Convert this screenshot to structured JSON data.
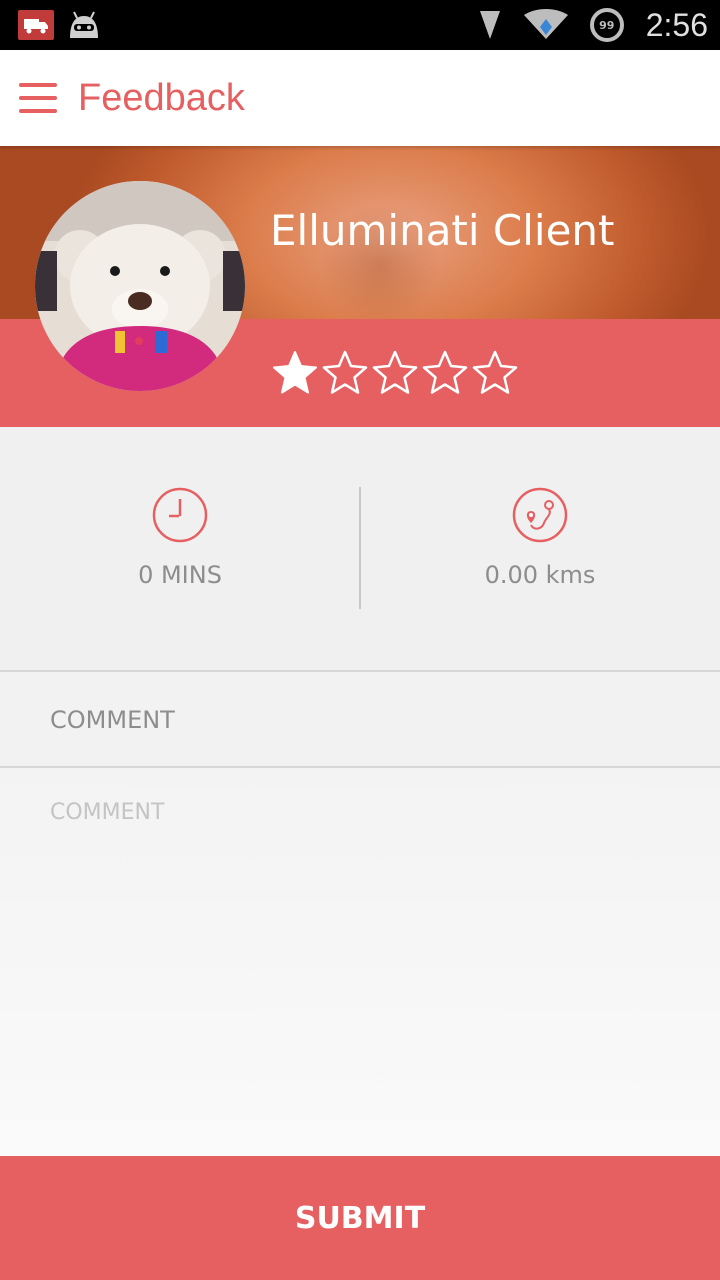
{
  "status_bar": {
    "time": "2:56",
    "battery": "99",
    "icons": [
      "truck-notification-icon",
      "android-notification-icon",
      "signal-icon",
      "wifi-icon",
      "battery-icon"
    ]
  },
  "toolbar": {
    "title": "Feedback",
    "menu_icon": "hamburger-menu-icon"
  },
  "header": {
    "client_name": "Elluminati Client",
    "rating": 1,
    "rating_max": 5
  },
  "stats": {
    "duration": "0 MINS",
    "distance": "0.00 kms",
    "duration_icon": "clock-icon",
    "distance_icon": "route-icon"
  },
  "comment": {
    "label": "COMMENT",
    "placeholder": "COMMENT",
    "value": ""
  },
  "submit": {
    "label": "SUBMIT"
  },
  "colors": {
    "accent": "#e65f61",
    "text_muted": "#8d8d8d",
    "toolbar_bg": "#ffffff",
    "status_bar_bg": "#000000"
  }
}
